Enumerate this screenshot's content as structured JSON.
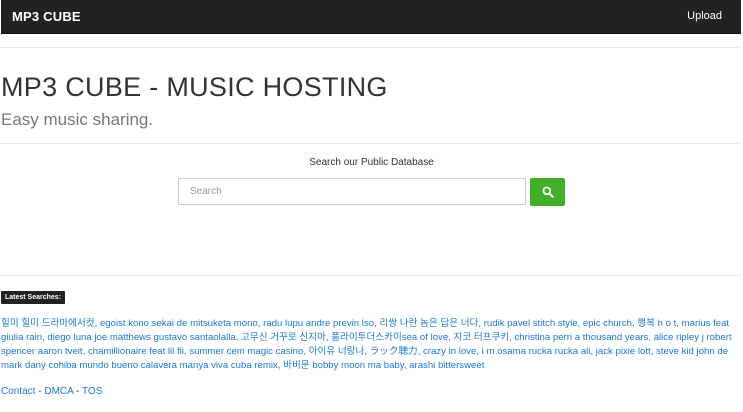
{
  "navbar": {
    "brand": "MP3 CUBE",
    "upload_link": "Upload"
  },
  "hero": {
    "title": "MP3 CUBE - MUSIC HOSTING",
    "subtitle": "Easy music sharing."
  },
  "search": {
    "caption": "Search our Public Database",
    "placeholder": "Search",
    "button_icon": "search-icon",
    "button_color": "#43b02a"
  },
  "latest": {
    "label": "Latest Searches:",
    "items": [
      "힐미 힐미 드라마에서컷",
      "egoist kono sekai de mitsuketa mono",
      "radu lupu andre previn lso",
      "리쌍 나란 놈은 답은 너다",
      "rudik pavel stitch style",
      "epic church",
      "행복 h o t",
      "marius feat giulia rain",
      "diego luna joe matthews gustavo santaolalla",
      "고무신 거꾸로 신지마",
      "플라이투더스카이sea of love",
      "지코 터프쿠키",
      "christina perri a thousand years",
      "alice ripley j robert spencer aaron tveit",
      "chamillionaire feat lil fli",
      "summer cem magic casino",
      "아이유 너랑나",
      "ラック聴力",
      "crazy in love",
      "i m osama rucka rucka ali",
      "jack pixie lott",
      "steve kid john de mark dany cohiba mundo bueno calavera manya viva cuba remix",
      "바비문 bobby moon ma baby",
      "arashi bittersweet"
    ]
  },
  "footer": {
    "contact": "Contact",
    "dmca": "DMCA",
    "tos": "TOS",
    "separator": " - "
  },
  "colors": {
    "navbar_bg": "#222222",
    "link": "#1a79d4",
    "accent_green": "#43b02a"
  }
}
